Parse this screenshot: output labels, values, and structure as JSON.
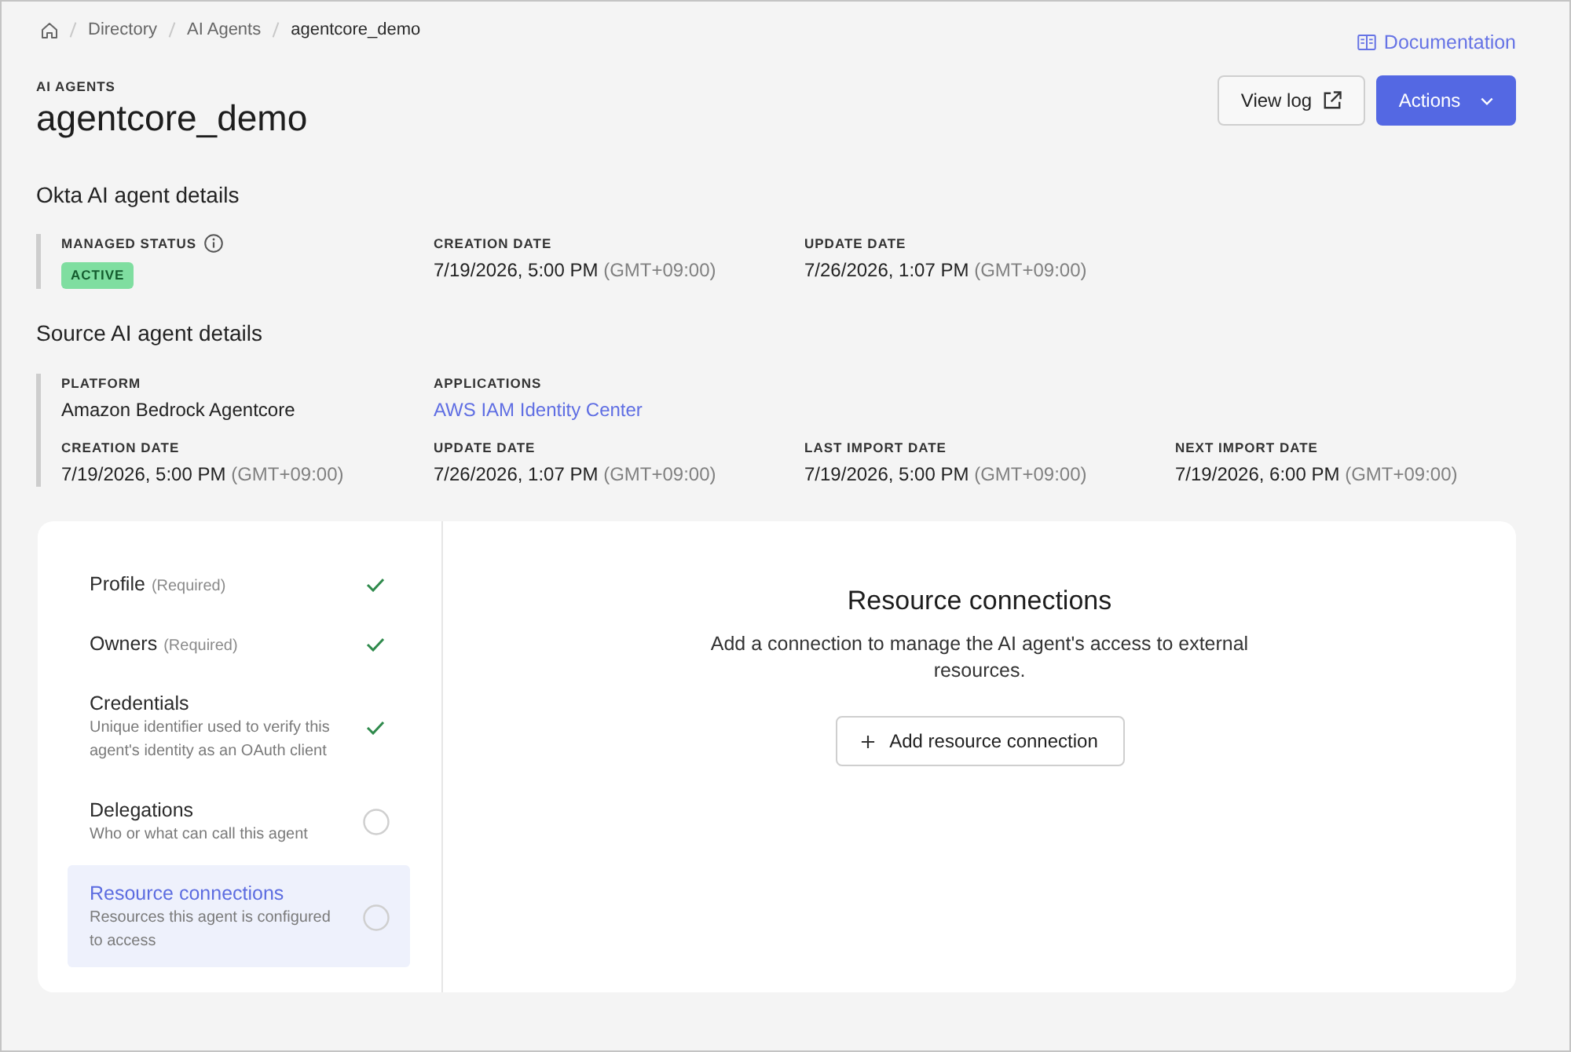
{
  "breadcrumbs": [
    {
      "label": "Directory",
      "current": false
    },
    {
      "label": "AI Agents",
      "current": false
    },
    {
      "label": "agentcore_demo",
      "current": true
    }
  ],
  "documentation_link": "Documentation",
  "header": {
    "eyebrow": "AI AGENTS",
    "title": "agentcore_demo"
  },
  "buttons": [
    {
      "label": "View log",
      "kind": "outline"
    },
    {
      "label": "Actions",
      "kind": "dropdown"
    }
  ],
  "okta_details": {
    "title": "Okta AI agent details",
    "rows": [
      [
        {
          "label": "MANAGED STATUS",
          "kind": "status",
          "value": "ACTIVE"
        },
        {
          "label": "CREATION DATE",
          "kind": "date",
          "value": "7/19/2026, 5:00 PM",
          "timezone": "(GMT+09:00)"
        },
        {
          "label": "UPDATE DATE",
          "kind": "date",
          "value": "7/26/2026, 1:07 PM",
          "timezone": "(GMT+09:00)"
        }
      ]
    ]
  },
  "source_details": {
    "title": "Source AI agent details",
    "rows": [
      [
        {
          "label": "PLATFORM",
          "kind": "text",
          "value": "Amazon Bedrock Agentcore"
        },
        {
          "label": "APPLICATIONS",
          "kind": "link",
          "value": "AWS IAM Identity Center"
        }
      ],
      [
        {
          "label": "CREATION DATE",
          "kind": "date",
          "value": "7/19/2026, 5:00 PM",
          "timezone": "(GMT+09:00)"
        },
        {
          "label": "UPDATE DATE",
          "kind": "date",
          "value": "7/26/2026, 1:07 PM",
          "timezone": "(GMT+09:00)"
        },
        {
          "label": "LAST IMPORT DATE",
          "kind": "date",
          "value": "7/19/2026, 5:00 PM",
          "timezone": "(GMT+09:00)"
        },
        {
          "label": "NEXT IMPORT DATE",
          "kind": "date",
          "value": "7/19/2026, 6:00 PM",
          "timezone": "(GMT+09:00)"
        }
      ]
    ]
  },
  "steps": [
    {
      "title": "Profile",
      "note": "(Required)",
      "done": true,
      "selected": false
    },
    {
      "title": "Owners",
      "note": "(Required)",
      "done": true,
      "selected": false
    },
    {
      "title": "Credentials",
      "description": "Unique identifier used to verify this agent's identity as an OAuth client",
      "done": true,
      "selected": false
    },
    {
      "title": "Delegations",
      "description": "Who or what can call this agent",
      "done": false,
      "selected": false
    },
    {
      "title": "Resource connections",
      "description": "Resources this agent is configured to access",
      "done": false,
      "selected": true
    }
  ],
  "panel": {
    "title": "Resource connections",
    "description": "Add a connection to manage the AI agent's access to external resources.",
    "button": "Add resource connection"
  }
}
